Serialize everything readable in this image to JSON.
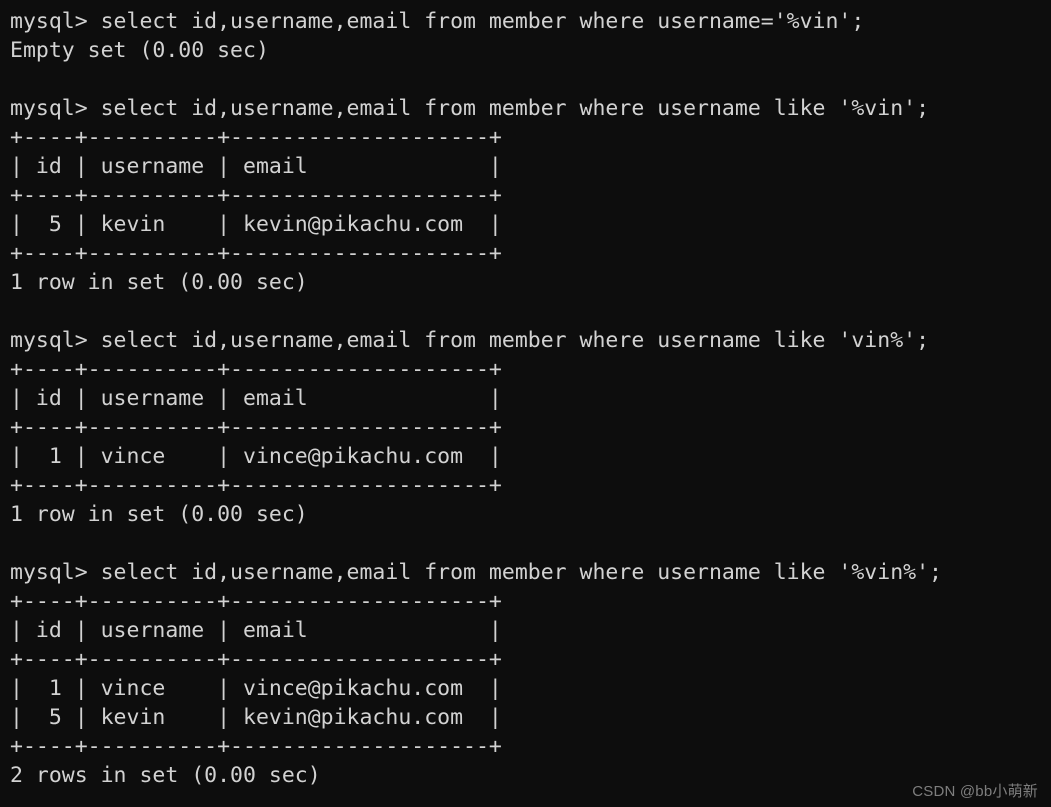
{
  "terminal": {
    "background_color": "#0d0d0d",
    "text_color": "#d2d2d2",
    "prompt": "mysql>",
    "watermark": "CSDN @bb小萌新",
    "lines": [
      "mysql> select id,username,email from member where username='%vin';",
      "Empty set (0.00 sec)",
      "",
      "mysql> select id,username,email from member where username like '%vin';",
      "+----+----------+--------------------+",
      "| id | username | email              |",
      "+----+----------+--------------------+",
      "|  5 | kevin    | kevin@pikachu.com  |",
      "+----+----------+--------------------+",
      "1 row in set (0.00 sec)",
      "",
      "mysql> select id,username,email from member where username like 'vin%';",
      "+----+----------+--------------------+",
      "| id | username | email              |",
      "+----+----------+--------------------+",
      "|  1 | vince    | vince@pikachu.com  |",
      "+----+----------+--------------------+",
      "1 row in set (0.00 sec)",
      "",
      "mysql> select id,username,email from member where username like '%vin%';",
      "+----+----------+--------------------+",
      "| id | username | email              |",
      "+----+----------+--------------------+",
      "|  1 | vince    | vince@pikachu.com  |",
      "|  5 | kevin    | kevin@pikachu.com  |",
      "+----+----------+--------------------+",
      "2 rows in set (0.00 sec)"
    ],
    "queries": [
      {
        "sql": "select id,username,email from member where username='%vin';",
        "result_status": "Empty set (0.00 sec)",
        "columns": [],
        "rows": []
      },
      {
        "sql": "select id,username,email from member where username like '%vin';",
        "result_status": "1 row in set (0.00 sec)",
        "columns": [
          "id",
          "username",
          "email"
        ],
        "rows": [
          [
            "5",
            "kevin",
            "kevin@pikachu.com"
          ]
        ]
      },
      {
        "sql": "select id,username,email from member where username like 'vin%';",
        "result_status": "1 row in set (0.00 sec)",
        "columns": [
          "id",
          "username",
          "email"
        ],
        "rows": [
          [
            "1",
            "vince",
            "vince@pikachu.com"
          ]
        ]
      },
      {
        "sql": "select id,username,email from member where username like '%vin%';",
        "result_status": "2 rows in set (0.00 sec)",
        "columns": [
          "id",
          "username",
          "email"
        ],
        "rows": [
          [
            "1",
            "vince",
            "vince@pikachu.com"
          ],
          [
            "5",
            "kevin",
            "kevin@pikachu.com"
          ]
        ]
      }
    ]
  }
}
